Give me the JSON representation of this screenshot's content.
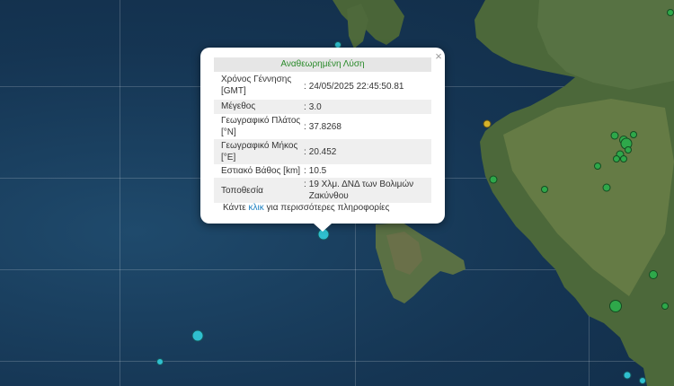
{
  "popup": {
    "title": "Αναθεωρημένη Λύση",
    "close_symbol": "×",
    "rows": [
      {
        "label": "Χρόνος Γέννησης [GMT]",
        "value": "24/05/2025 22:45:50.81"
      },
      {
        "label": "Μέγεθος",
        "value": "3.0"
      },
      {
        "label": "Γεωγραφικό Πλάτος [°N]",
        "value": "37.8268"
      },
      {
        "label": "Γεωγραφικό Μήκος [°E]",
        "value": "20.452"
      },
      {
        "label": "Εστιακό Βάθος [km]",
        "value": "10.5"
      },
      {
        "label": "Τοποθεσία",
        "value": "19 Χλμ. ΔΝΔ των Βολιμών Ζακύνθου"
      }
    ],
    "separator": ":",
    "footer_prefix": "Κάντε ",
    "footer_link": "κλικ",
    "footer_suffix": " για περισσότερες πληροφορίες"
  },
  "colors": {
    "sea": "#173a5a",
    "land": "#4e6a3c",
    "quake_recent": "#2fbfcf",
    "quake_day": "#2ea84a",
    "quake_week": "#d6b22a"
  }
}
